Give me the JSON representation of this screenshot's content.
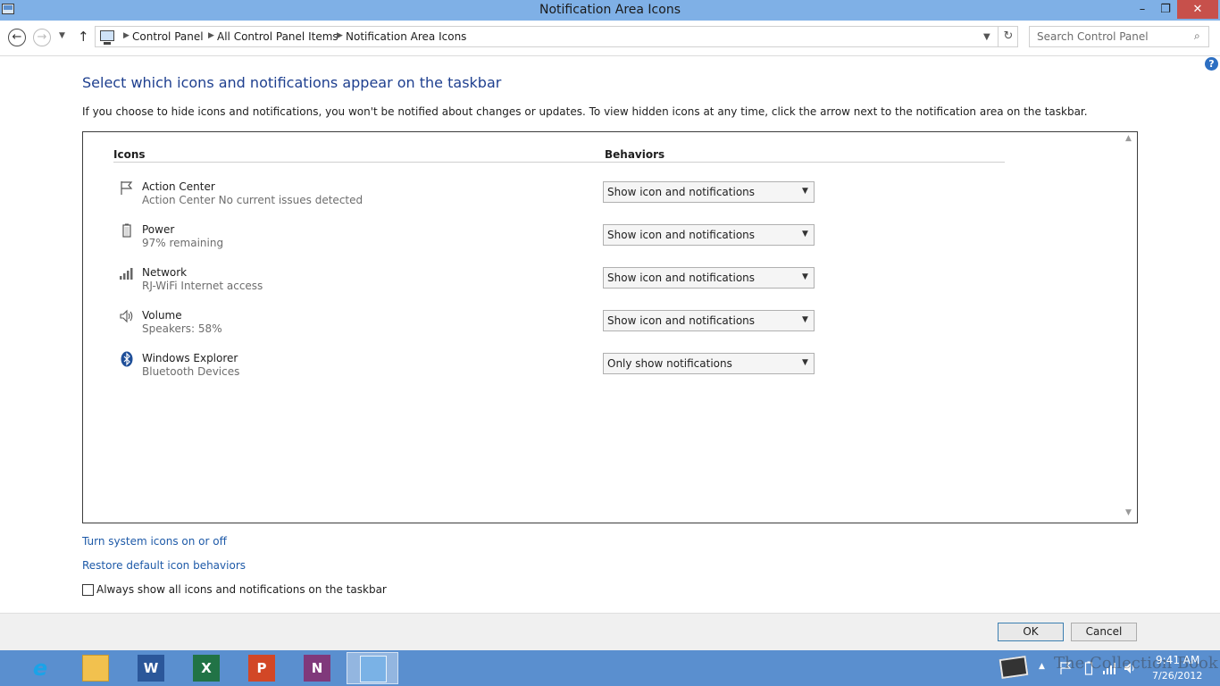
{
  "window": {
    "title": "Notification Area Icons",
    "min": "–",
    "max": "❐",
    "close": "✕"
  },
  "nav": {
    "back": "←",
    "forward": "→",
    "recent": "▼",
    "up": "↑",
    "breadcrumb": [
      "Control Panel",
      "All Control Panel Items",
      "Notification Area Icons"
    ],
    "separator": "▶",
    "dropdown": "▼",
    "refresh": "↻",
    "search_placeholder": "Search Control Panel",
    "search_glyph": "⌕"
  },
  "help": "?",
  "content": {
    "title": "Select which icons and notifications appear on the taskbar",
    "description": "If you choose to hide icons and notifications, you won't be notified about changes or updates. To view hidden icons at any time, click the arrow next to the notification area on the taskbar.",
    "col_icons": "Icons",
    "col_behaviors": "Behaviors",
    "rows": [
      {
        "name": "Action Center",
        "detail": "Action Center  No current issues detected",
        "behavior": "Show icon and notifications",
        "icon": "flag-icon"
      },
      {
        "name": "Power",
        "detail": "97% remaining",
        "behavior": "Show icon and notifications",
        "icon": "battery-icon"
      },
      {
        "name": "Network",
        "detail": "RJ-WiFi Internet access",
        "behavior": "Show icon and notifications",
        "icon": "signal-icon"
      },
      {
        "name": "Volume",
        "detail": "Speakers: 58%",
        "behavior": "Show icon and notifications",
        "icon": "speaker-icon"
      },
      {
        "name": "Windows Explorer",
        "detail": "Bluetooth Devices",
        "behavior": "Only show notifications",
        "icon": "bluetooth-icon"
      }
    ],
    "select_arrow": "▼",
    "scroll_up": "▲",
    "scroll_down": "▼",
    "link_system_icons": "Turn system icons on or off",
    "link_restore": "Restore default icon behaviors",
    "checkbox_label": "Always show all icons and notifications on the taskbar",
    "checkbox_checked": false
  },
  "footer": {
    "ok": "OK",
    "cancel": "Cancel"
  },
  "taskbar": {
    "apps": [
      {
        "name": "internet-explorer",
        "glyph": "e"
      },
      {
        "name": "file-explorer",
        "glyph": ""
      },
      {
        "name": "word",
        "glyph": "W"
      },
      {
        "name": "excel",
        "glyph": "X"
      },
      {
        "name": "powerpoint",
        "glyph": "P"
      },
      {
        "name": "onenote",
        "glyph": "N"
      },
      {
        "name": "control-panel",
        "glyph": ""
      }
    ],
    "tray_arrow": "▲",
    "watermark": "The Collection Book",
    "time": "9:41 AM",
    "date": "7/26/2012"
  },
  "colors": {
    "titlebar": "#7fb0e6",
    "heading": "#1e3f8f",
    "link": "#1e5aa8",
    "taskbar": "#5a8fcf",
    "close": "#c7504b"
  }
}
